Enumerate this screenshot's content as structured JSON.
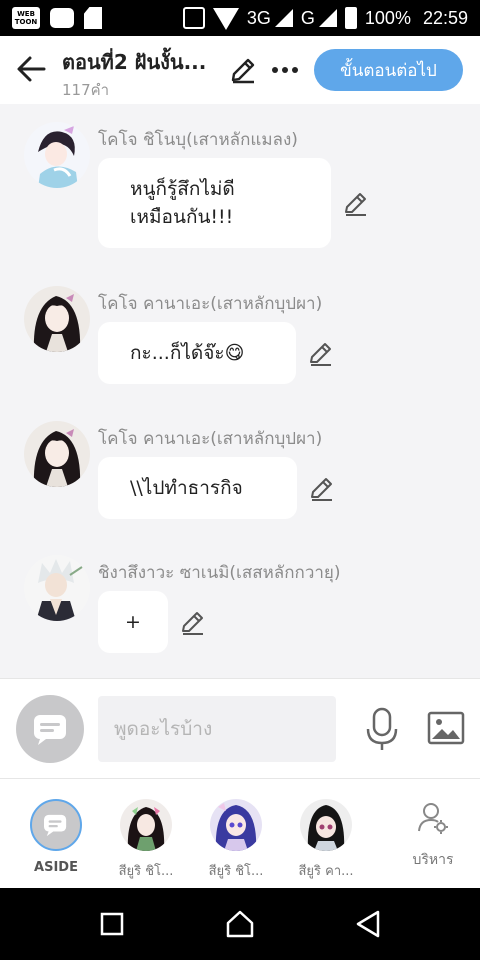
{
  "status_bar": {
    "network": "3G",
    "network_secondary": "G",
    "battery": "100%",
    "time": "22:59"
  },
  "header": {
    "title": "ตอนที่2 ฝันงั้น...",
    "word_count": "117คำ",
    "next_button": "ขั้นตอนต่อไป"
  },
  "messages": [
    {
      "sender": "โคโจ ชิโนบุ(เสาหลักแมลง)",
      "lines": [
        "หนูก็รู้สึกไม่ดี",
        "เหมือนกัน!!!"
      ]
    },
    {
      "sender": "โคโจ คานาเอะ(เสาหลักบุปผา)",
      "lines": [
        "กะ...ก็ได้จ๊ะ😋"
      ]
    },
    {
      "sender": "โคโจ คานาเอะ(เสาหลักบุปผา)",
      "lines": [
        "\\\\ไปทำธารกิจ"
      ]
    },
    {
      "sender": "ชิงาสึงาวะ ซาเนมิ(เสสหลักกวายุ)",
      "lines": [
        "+"
      ]
    }
  ],
  "composer": {
    "placeholder": "พูดอะไรบ้าง"
  },
  "characters": [
    {
      "label": "ASIDE"
    },
    {
      "label": "สียูริ ชิโ..."
    },
    {
      "label": "สียูริ ชิโ..."
    },
    {
      "label": "สียูริ คา..."
    }
  ],
  "manage_label": "บริหาร",
  "colors": {
    "accent": "#5fa7ea",
    "background": "#f4f4f6"
  }
}
